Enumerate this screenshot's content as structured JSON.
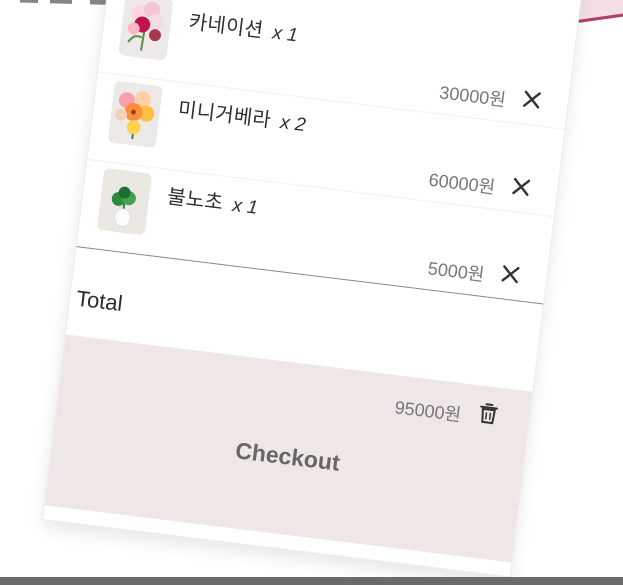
{
  "cart": {
    "items": [
      {
        "name": "카네이션",
        "quantity": "x 1",
        "price": "30000원",
        "thumbnail_icon": "carnation-photo-icon"
      },
      {
        "name": "미니거베라",
        "quantity": "x 2",
        "price": "60000원",
        "thumbnail_icon": "mini-gerbera-photo-icon"
      },
      {
        "name": "불노초",
        "quantity": "x 1",
        "price": "5000원",
        "thumbnail_icon": "bulnocho-plant-photo-icon"
      }
    ],
    "total_label": "Total",
    "total_value": "95000원",
    "checkout_label": "Checkout",
    "remove_icon": "close-icon",
    "clear_icon": "trash-icon"
  },
  "colors": {
    "accent": "#b3405e",
    "checkout_background": "#efe6e6"
  }
}
